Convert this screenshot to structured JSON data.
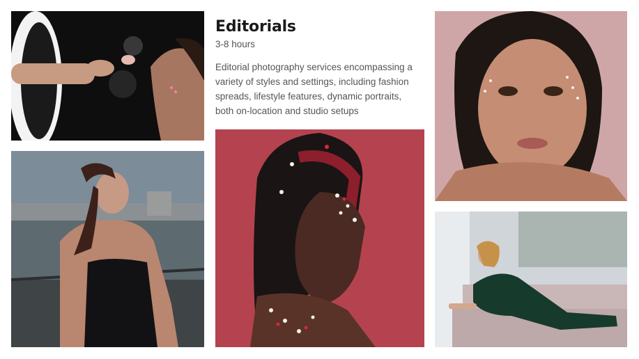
{
  "section": {
    "title": "Editorials",
    "duration": "3-8 hours",
    "description": "Editorial photography services encompassing a variety of styles and settings, including fashion spreads, lifestyle features, dynamic portraits, both on-location and studio setups"
  },
  "colors": {
    "title_text": "#1b1b1b",
    "body_text": "#555555",
    "background": "#ffffff"
  }
}
